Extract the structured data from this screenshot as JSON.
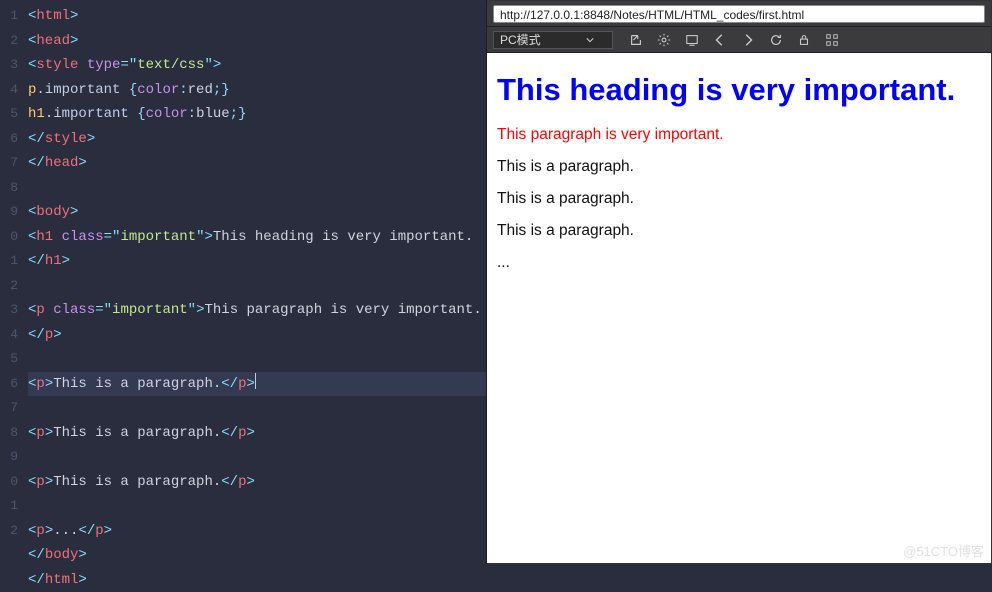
{
  "editor": {
    "line_numbers": [
      "1",
      "2",
      "3",
      "4",
      "5",
      "6",
      "7",
      "8",
      "9",
      "0",
      "1",
      "2",
      "3",
      "4",
      "5",
      "6",
      "7",
      "8",
      "9",
      "0",
      "1",
      "2"
    ],
    "highlighted_line_index": 15,
    "lines": [
      [
        [
          "pn",
          "<"
        ],
        [
          "tag",
          "html"
        ],
        [
          "pn",
          ">"
        ]
      ],
      [
        [
          "pn",
          "<"
        ],
        [
          "tag",
          "head"
        ],
        [
          "pn",
          ">"
        ]
      ],
      [
        [
          "pn",
          "<"
        ],
        [
          "tag",
          "style"
        ],
        [
          "tx",
          " "
        ],
        [
          "at",
          "type"
        ],
        [
          "pn",
          "="
        ],
        [
          "pn",
          "\""
        ],
        [
          "st",
          "text/css"
        ],
        [
          "pn",
          "\""
        ],
        [
          "pn",
          ">"
        ]
      ],
      [
        [
          "sel",
          "p"
        ],
        [
          "selcls",
          ".important"
        ],
        [
          "tx",
          " "
        ],
        [
          "pn",
          "{"
        ],
        [
          "at",
          "color"
        ],
        [
          "pn",
          ":"
        ],
        [
          "tx",
          "red"
        ],
        [
          "pn",
          ";"
        ],
        [
          "pn",
          "}"
        ]
      ],
      [
        [
          "sel",
          "h1"
        ],
        [
          "selcls",
          ".important"
        ],
        [
          "tx",
          " "
        ],
        [
          "pn",
          "{"
        ],
        [
          "at",
          "color"
        ],
        [
          "pn",
          ":"
        ],
        [
          "tx",
          "blue"
        ],
        [
          "pn",
          ";"
        ],
        [
          "pn",
          "}"
        ]
      ],
      [
        [
          "pn",
          "</"
        ],
        [
          "tag",
          "style"
        ],
        [
          "pn",
          ">"
        ]
      ],
      [
        [
          "pn",
          "</"
        ],
        [
          "tag",
          "head"
        ],
        [
          "pn",
          ">"
        ]
      ],
      [],
      [
        [
          "pn",
          "<"
        ],
        [
          "tag",
          "body"
        ],
        [
          "pn",
          ">"
        ]
      ],
      [
        [
          "pn",
          "<"
        ],
        [
          "tag",
          "h1"
        ],
        [
          "tx",
          " "
        ],
        [
          "at",
          "class"
        ],
        [
          "pn",
          "="
        ],
        [
          "pn",
          "\""
        ],
        [
          "st",
          "important"
        ],
        [
          "pn",
          "\""
        ],
        [
          "pn",
          ">"
        ],
        [
          "tx",
          "This heading is very important."
        ],
        [
          "pn",
          "</"
        ],
        [
          "tag",
          "h1"
        ],
        [
          "pn",
          ">"
        ]
      ],
      [],
      [
        [
          "pn",
          "<"
        ],
        [
          "tag",
          "p"
        ],
        [
          "tx",
          " "
        ],
        [
          "at",
          "class"
        ],
        [
          "pn",
          "="
        ],
        [
          "pn",
          "\""
        ],
        [
          "st",
          "important"
        ],
        [
          "pn",
          "\""
        ],
        [
          "pn",
          ">"
        ],
        [
          "tx",
          "This paragraph is very important."
        ],
        [
          "pn",
          "</"
        ],
        [
          "tag",
          "p"
        ],
        [
          "pn",
          ">"
        ]
      ],
      [],
      [
        [
          "pn",
          "<"
        ],
        [
          "tag",
          "p"
        ],
        [
          "pn",
          ">"
        ],
        [
          "tx",
          "This is a paragraph."
        ],
        [
          "pn",
          "</"
        ],
        [
          "tag",
          "p"
        ],
        [
          "pn",
          ">"
        ]
      ],
      [],
      [
        [
          "pn",
          "<"
        ],
        [
          "tag",
          "p"
        ],
        [
          "pn",
          ">"
        ],
        [
          "tx",
          "This is a paragraph."
        ],
        [
          "pn",
          "</"
        ],
        [
          "tag",
          "p"
        ],
        [
          "pn",
          ">"
        ]
      ],
      [],
      [
        [
          "pn",
          "<"
        ],
        [
          "tag",
          "p"
        ],
        [
          "pn",
          ">"
        ],
        [
          "tx",
          "This is a paragraph."
        ],
        [
          "pn",
          "</"
        ],
        [
          "tag",
          "p"
        ],
        [
          "pn",
          ">"
        ]
      ],
      [],
      [
        [
          "pn",
          "<"
        ],
        [
          "tag",
          "p"
        ],
        [
          "pn",
          ">"
        ],
        [
          "tx",
          "..."
        ],
        [
          "pn",
          "</"
        ],
        [
          "tag",
          "p"
        ],
        [
          "pn",
          ">"
        ]
      ],
      [
        [
          "pn",
          "</"
        ],
        [
          "tag",
          "body"
        ],
        [
          "pn",
          ">"
        ]
      ],
      [
        [
          "pn",
          "</"
        ],
        [
          "tag",
          "html"
        ],
        [
          "pn",
          ">"
        ]
      ]
    ]
  },
  "browser": {
    "url": "http://127.0.0.1:8848/Notes/HTML/HTML_codes/first.html",
    "mode_label": "PC模式"
  },
  "page": {
    "h1": "This heading is very important.",
    "p_important": "This paragraph is very important.",
    "p1": "This is a paragraph.",
    "p2": "This is a paragraph.",
    "p3": "This is a paragraph.",
    "p_dots": "..."
  },
  "watermark": "@51CTO博客"
}
